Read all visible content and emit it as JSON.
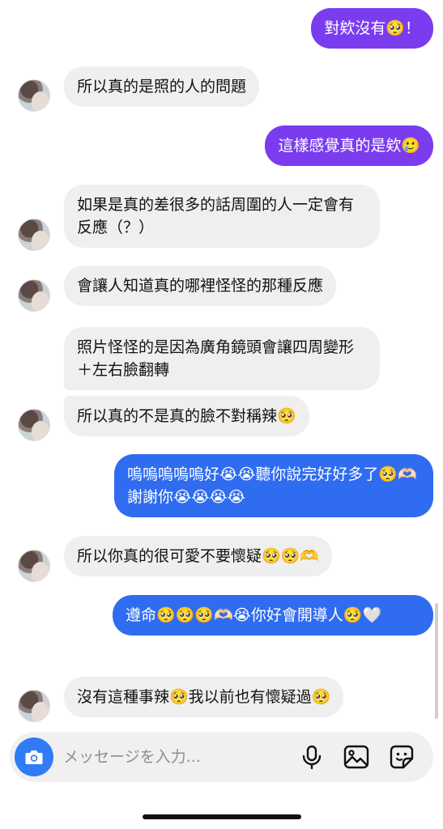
{
  "messages": [
    {
      "id": 1,
      "side": "out",
      "text": "對欸沒有🥺！"
    },
    {
      "id": 2,
      "side": "in",
      "text": "所以真的是照的人的問題"
    },
    {
      "id": 3,
      "side": "out",
      "text": "這樣感覺真的是欸🥲"
    },
    {
      "id": 4,
      "side": "in",
      "text": "如果是真的差很多的話周圍的人一定會有反應（？）"
    },
    {
      "id": 5,
      "side": "in",
      "text": "會讓人知道真的哪裡怪怪的那種反應"
    },
    {
      "id": 6,
      "side": "in",
      "text": "照片怪怪的是因為廣角鏡頭會讓四周變形＋左右臉翻轉"
    },
    {
      "id": 7,
      "side": "in",
      "text": "所以真的不是真的臉不對稱辣🥺"
    },
    {
      "id": 8,
      "side": "out",
      "text": "嗚嗚嗚嗚嗚好😭😭聽你說完好好多了🥺🫶🏻謝謝你😭😭😭😭"
    },
    {
      "id": 9,
      "side": "in",
      "text": "所以你真的很可愛不要懷疑🥺🥺🫶"
    },
    {
      "id": 10,
      "side": "out",
      "text": "遵命🥺🥺🥺🫶🏻😭你好會開導人🥺🤍"
    },
    {
      "id": 11,
      "side": "in",
      "text": "沒有這種事辣🥺我以前也有懷疑過🥺"
    }
  ],
  "composer": {
    "placeholder": "メッセージを入力...",
    "icons": [
      "camera-icon",
      "microphone-icon",
      "gallery-icon",
      "sticker-icon"
    ]
  },
  "colors": {
    "out_purple": "#7b3cf0",
    "out_blue": "#2f6cf0",
    "in_bubble": "#efefef",
    "camera_button": "#2f7cf6"
  }
}
